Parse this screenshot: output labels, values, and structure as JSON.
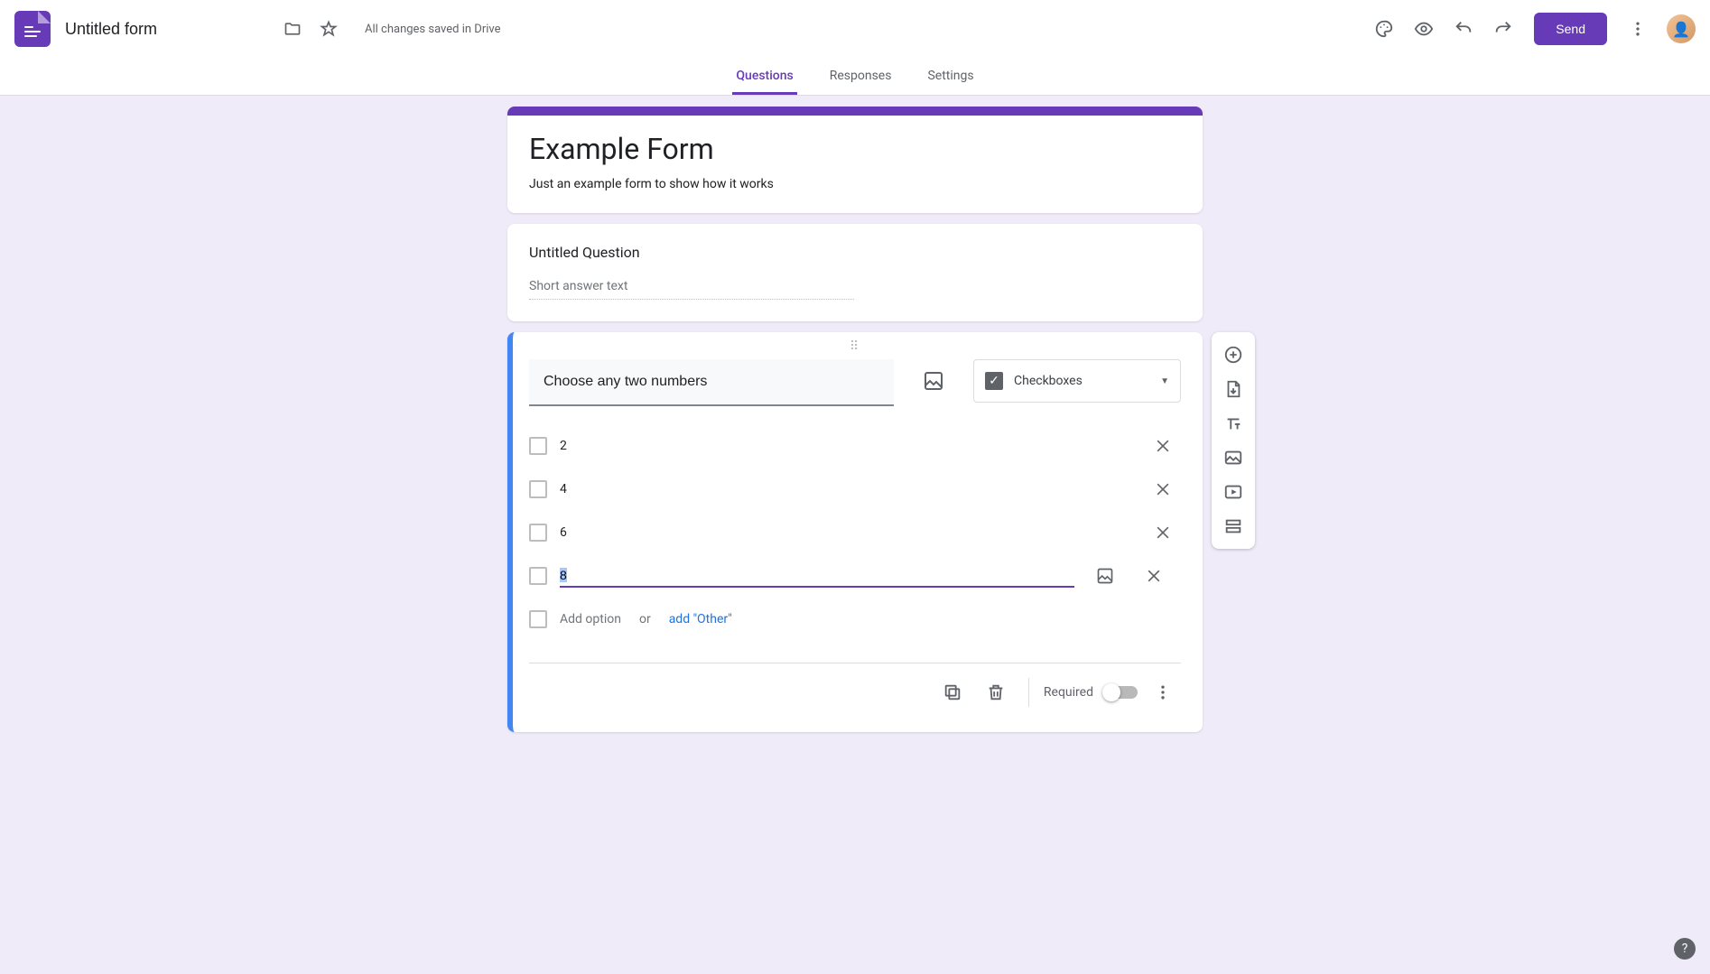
{
  "header": {
    "form_name": "Untitled form",
    "save_status": "All changes saved in Drive",
    "send_label": "Send"
  },
  "tabs": {
    "questions": "Questions",
    "responses": "Responses",
    "settings": "Settings"
  },
  "form": {
    "title": "Example Form",
    "description": "Just an example form to show how it works"
  },
  "question1": {
    "title": "Untitled Question",
    "placeholder": "Short answer text"
  },
  "question2": {
    "title": "Choose any two numbers",
    "type_label": "Checkboxes",
    "options": [
      "2",
      "4",
      "6"
    ],
    "editing_option": "8",
    "add_option_text": "Add option",
    "or_text": "or",
    "add_other_text": "add \"Other\"",
    "required_label": "Required"
  }
}
